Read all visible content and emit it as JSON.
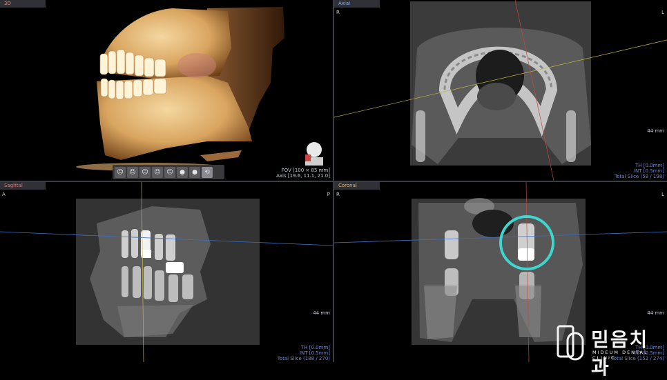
{
  "panes": {
    "view3d": {
      "label": "3D",
      "fov": "FOV [100 × 85 mm]",
      "axis": "Axis [19.6, 11.1, 21.0]"
    },
    "axial": {
      "label": "Axial",
      "left": "R",
      "right": "L",
      "scale": "44 mm",
      "th": "TH [0.0mm]",
      "int": "INT [0.5mm]",
      "slice": "Total Slice (58 / 198)"
    },
    "sagittal": {
      "label": "Sagittal",
      "left": "A",
      "right": "P",
      "scale": "44 mm",
      "th": "TH [0.0mm]",
      "int": "INT [0.5mm]",
      "slice": "Total Slice (188 / 270)"
    },
    "coronal": {
      "label": "Coronal",
      "left": "R",
      "right": "L",
      "scale": "44 mm",
      "th": "TH [0.0mm]",
      "int": "INT [0.5mm]",
      "slice": "Total Slice (152 / 274)"
    }
  },
  "toolbar": {
    "buttons": [
      "face-left-icon",
      "face-front-left-icon",
      "face-front-icon",
      "face-front-right-icon",
      "face-right-icon",
      "head-top-icon",
      "head-bottom-icon",
      "reset-view-icon"
    ]
  },
  "logo": {
    "korean": "믿음치과",
    "english": "MIDEUM DENTAL CLINIC"
  },
  "colors": {
    "tab_text_3d": "#d98c8c",
    "tab_text_axial": "#8fa8ff",
    "tab_text_sagittal": "#e37070",
    "tab_text_coronal": "#e3b25a",
    "info_blue": "#6f86d8",
    "highlight_ring": "#3fd6d0"
  }
}
